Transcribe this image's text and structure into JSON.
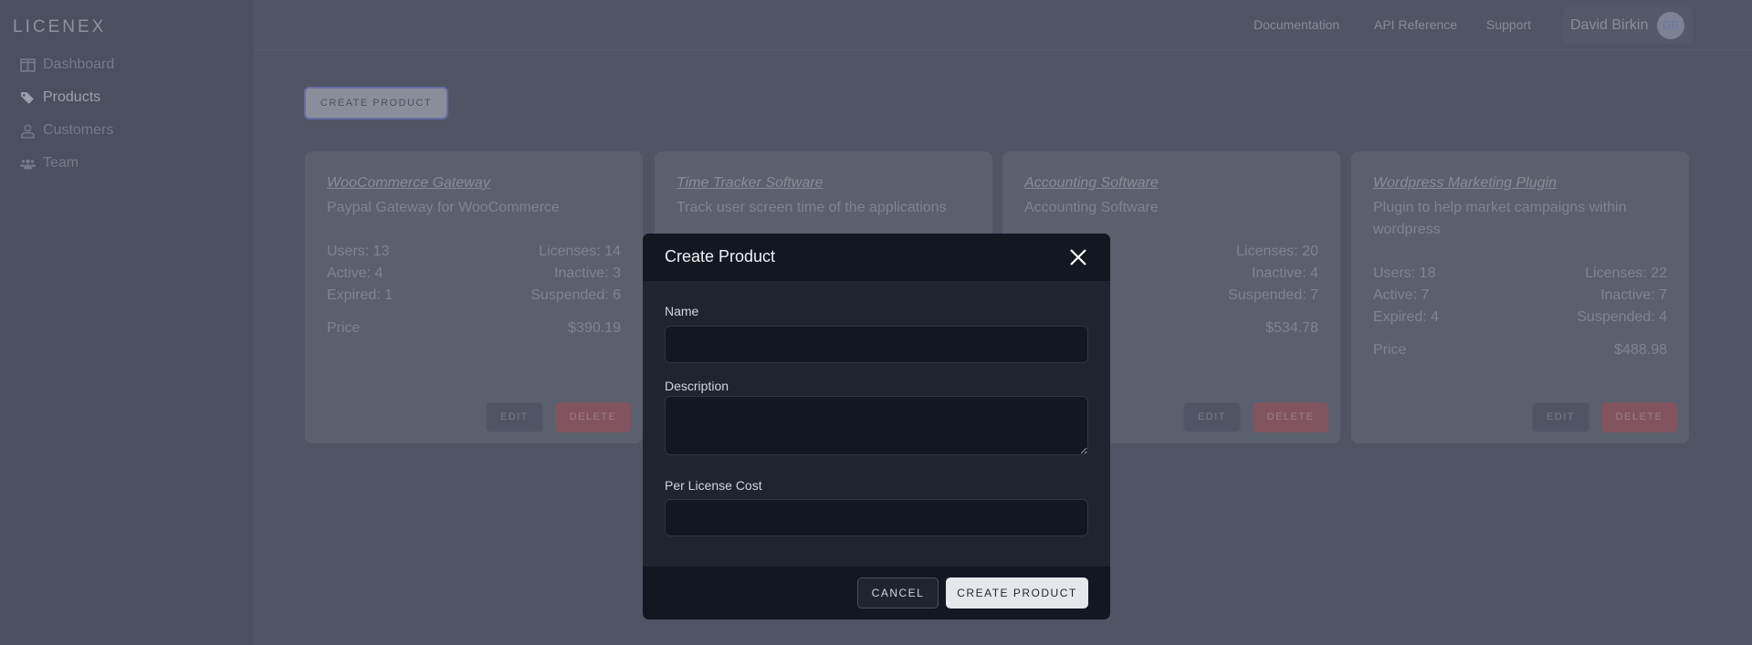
{
  "app": {
    "logo": "LICENEX"
  },
  "sidebar": {
    "items": [
      {
        "label": "Dashboard",
        "icon": "dashboard-icon"
      },
      {
        "label": "Products",
        "icon": "tags-icon",
        "active": true
      },
      {
        "label": "Customers",
        "icon": "user-icon"
      },
      {
        "label": "Team",
        "icon": "users-icon"
      }
    ]
  },
  "header": {
    "links": [
      "Documentation",
      "API Reference",
      "Support"
    ],
    "user": {
      "name": "David Birkin",
      "initials": "DB"
    }
  },
  "main": {
    "create_button": "CREATE PRODUCT"
  },
  "products": [
    {
      "name": "WooCommerce Gateway",
      "description": "Paypal Gateway for WooCommerce",
      "stats": [
        [
          "Users: 13",
          "Licenses: 14"
        ],
        [
          "Active: 4",
          "Inactive: 3"
        ],
        [
          "Expired: 1",
          "Suspended: 6"
        ]
      ],
      "price_label": "Price",
      "price": "$390.19",
      "edit": "EDIT",
      "delete": "DELETE"
    },
    {
      "name": "Time Tracker Software",
      "description": "Track user screen time of the applications"
    },
    {
      "name": "Accounting Software",
      "description": "Accounting Software",
      "stats": [
        [
          "",
          "Licenses: 20"
        ],
        [
          "",
          "Inactive: 4"
        ],
        [
          "",
          "Suspended: 7"
        ]
      ],
      "price_label": "",
      "price": "$534.78",
      "edit": "EDIT",
      "delete": "DELETE"
    },
    {
      "name": "Wordpress Marketing Plugin",
      "description": "Plugin to help market campaigns within wordpress",
      "stats": [
        [
          "Users: 18",
          "Licenses: 22"
        ],
        [
          "Active: 7",
          "Inactive: 7"
        ],
        [
          "Expired: 4",
          "Suspended: 4"
        ]
      ],
      "price_label": "Price",
      "price": "$488.98",
      "edit": "EDIT",
      "delete": "DELETE"
    }
  ],
  "modal": {
    "title": "Create Product",
    "fields": {
      "name": {
        "label": "Name",
        "value": ""
      },
      "description": {
        "label": "Description",
        "value": ""
      },
      "cost": {
        "label": "Per License Cost",
        "value": ""
      }
    },
    "cancel": "CANCEL",
    "submit": "CREATE PRODUCT"
  },
  "colors": {
    "accent": "#676ea0",
    "delete": "#82545f",
    "modal_bg": "#1e2430"
  }
}
